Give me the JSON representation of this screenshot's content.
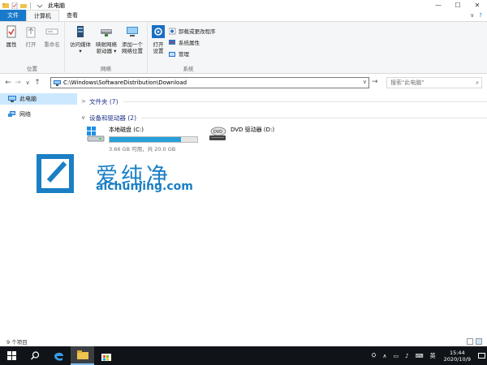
{
  "window": {
    "title": "此电脑",
    "minimize": "—",
    "maximize": "☐",
    "close": "✕"
  },
  "ribbon_tabs": [
    {
      "label": "文件"
    },
    {
      "label": "计算机"
    },
    {
      "label": "查看"
    }
  ],
  "ribbon": {
    "location_group": {
      "label": "位置",
      "properties": "属性",
      "open": "打开",
      "rename": "重命名"
    },
    "network_group": {
      "label": "网络",
      "access_media": [
        "访问媒体",
        "▾"
      ],
      "map_drive": [
        "映射网络",
        "驱动器 ▾"
      ],
      "add_location": [
        "添加一个",
        "网络位置"
      ]
    },
    "system_group": {
      "label": "系统",
      "open_settings": [
        "打开",
        "设置"
      ],
      "uninstall": "卸载或更改程序",
      "system_properties": "系统属性",
      "manage": "管理"
    }
  },
  "navigation": {
    "back": "←",
    "forward": "→",
    "recent": "∨",
    "up": "↑"
  },
  "address": {
    "value": "C:\\Windows\\SoftwareDistribution\\Download",
    "dropdown": "∨",
    "go": "→"
  },
  "search": {
    "placeholder": "搜索\"此电脑\"",
    "icon": "⌕"
  },
  "nav_pane": {
    "items": [
      {
        "label": "此电脑",
        "icon": "computer-icon"
      },
      {
        "label": "网络",
        "icon": "network-icon"
      }
    ]
  },
  "content": {
    "folders_section": {
      "label": "文件夹 (7)",
      "chevron": ">"
    },
    "devices_section": {
      "label": "设备和驱动器 (2)",
      "chevron": "∨"
    },
    "drives": [
      {
        "name": "本地磁盘 (C:)",
        "detail": "3.66 GB 可用，共 20.0 GB",
        "used_fraction": 0.817
      },
      {
        "name": "DVD 驱动器 (D:)",
        "detail": ""
      }
    ]
  },
  "watermark": {
    "text": "爱纯净",
    "url": "aichunjing.com"
  },
  "status": {
    "item_count": "9 个项目"
  },
  "taskbar": {
    "ime_label": "英",
    "time": "15:44",
    "date": "2020/10/9"
  },
  "colors": {
    "accent": "#1979ca",
    "selection": "#cce8ff",
    "drive_bar": "#26a0da",
    "taskbar": "#101418",
    "watermark": "#1a7fc4"
  }
}
